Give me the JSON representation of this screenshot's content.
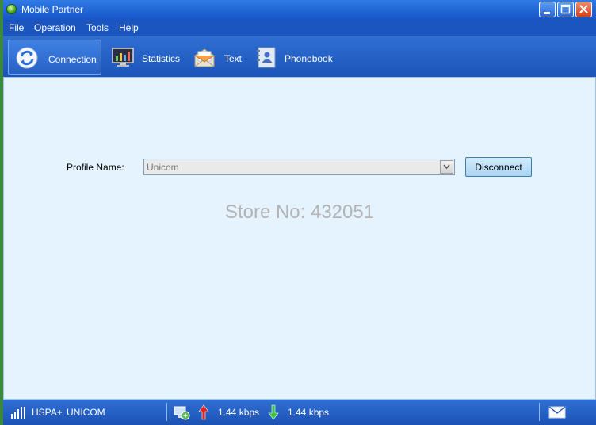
{
  "window": {
    "title": "Mobile Partner"
  },
  "menu": {
    "items": [
      "File",
      "Operation",
      "Tools",
      "Help"
    ]
  },
  "toolbar": {
    "tabs": [
      {
        "label": "Connection",
        "icon": "connection-icon",
        "active": true
      },
      {
        "label": "Statistics",
        "icon": "monitor-chart-icon",
        "active": false
      },
      {
        "label": "Text",
        "icon": "envelope-icon",
        "active": false
      },
      {
        "label": "Phonebook",
        "icon": "phonebook-icon",
        "active": false
      }
    ]
  },
  "connection": {
    "profile_label": "Profile Name:",
    "profile_value": "Unicom",
    "disconnect_label": "Disconnect"
  },
  "watermark": "Store No: 432051",
  "status": {
    "network": "HSPA+",
    "operator": "UNICOM",
    "upload": "1.44 kbps",
    "download": "1.44 kbps"
  },
  "colors": {
    "title_bar": "#1856c8",
    "toolbar": "#1c54b8",
    "content_bg": "#e4f3fd",
    "button_bg": "#a9d4f3"
  }
}
